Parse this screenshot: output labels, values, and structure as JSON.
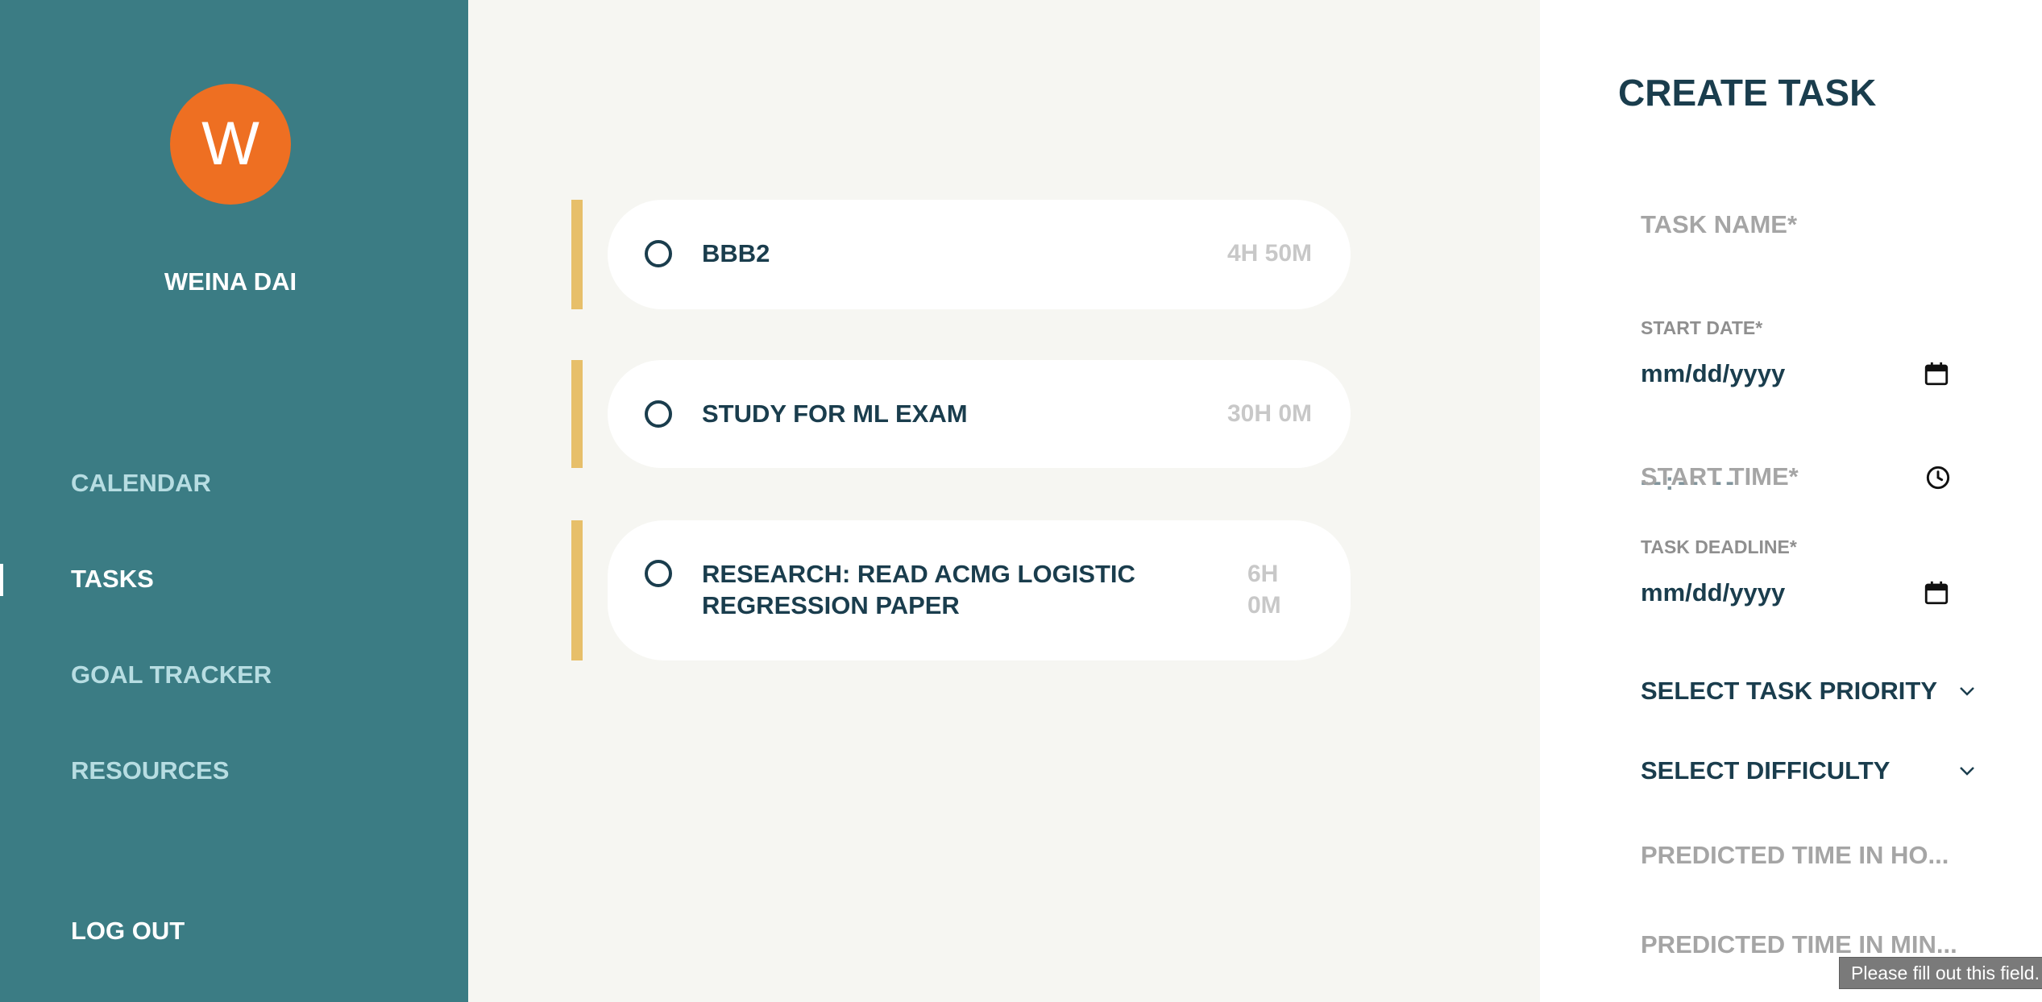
{
  "user": {
    "avatar_letter": "W",
    "name": "WEINA DAI"
  },
  "nav": {
    "calendar": "CALENDAR",
    "tasks": "TASKS",
    "goal_tracker": "GOAL TRACKER",
    "resources": "RESOURCES",
    "logout": "LOG OUT"
  },
  "tasks": [
    {
      "title": "BBB2",
      "time": "4H 50M"
    },
    {
      "title": "STUDY FOR ML EXAM",
      "time": "30H 0M"
    },
    {
      "title_line1": "RESEARCH: READ ACMG LOGISTIC",
      "title_line2": "REGRESSION PAPER",
      "time_line1": "6H",
      "time_line2": "0M"
    }
  ],
  "form": {
    "title": "CREATE TASK",
    "task_name_placeholder": "TASK NAME*",
    "start_date_label": "START DATE*",
    "start_date_value": "mm/dd/yyyy",
    "start_time_placeholder": "START TIME*",
    "start_time_value": "--:-- --",
    "deadline_label": "TASK DEADLINE*",
    "deadline_value": "mm/dd/yyyy",
    "priority_select": "SELECT TASK PRIORITY",
    "difficulty_select": "SELECT DIFFICULTY",
    "predicted_hours_placeholder": "PREDICTED TIME IN HO...",
    "predicted_minutes_placeholder": "PREDICTED TIME IN MIN..."
  },
  "tooltip": "Please fill out this field.",
  "colors": {
    "sidebar": "#3b7c84",
    "avatar": "#ee6f22",
    "accent": "#e7bf6a",
    "text_dark": "#1a3d4d",
    "background": "#f6f6f2"
  }
}
